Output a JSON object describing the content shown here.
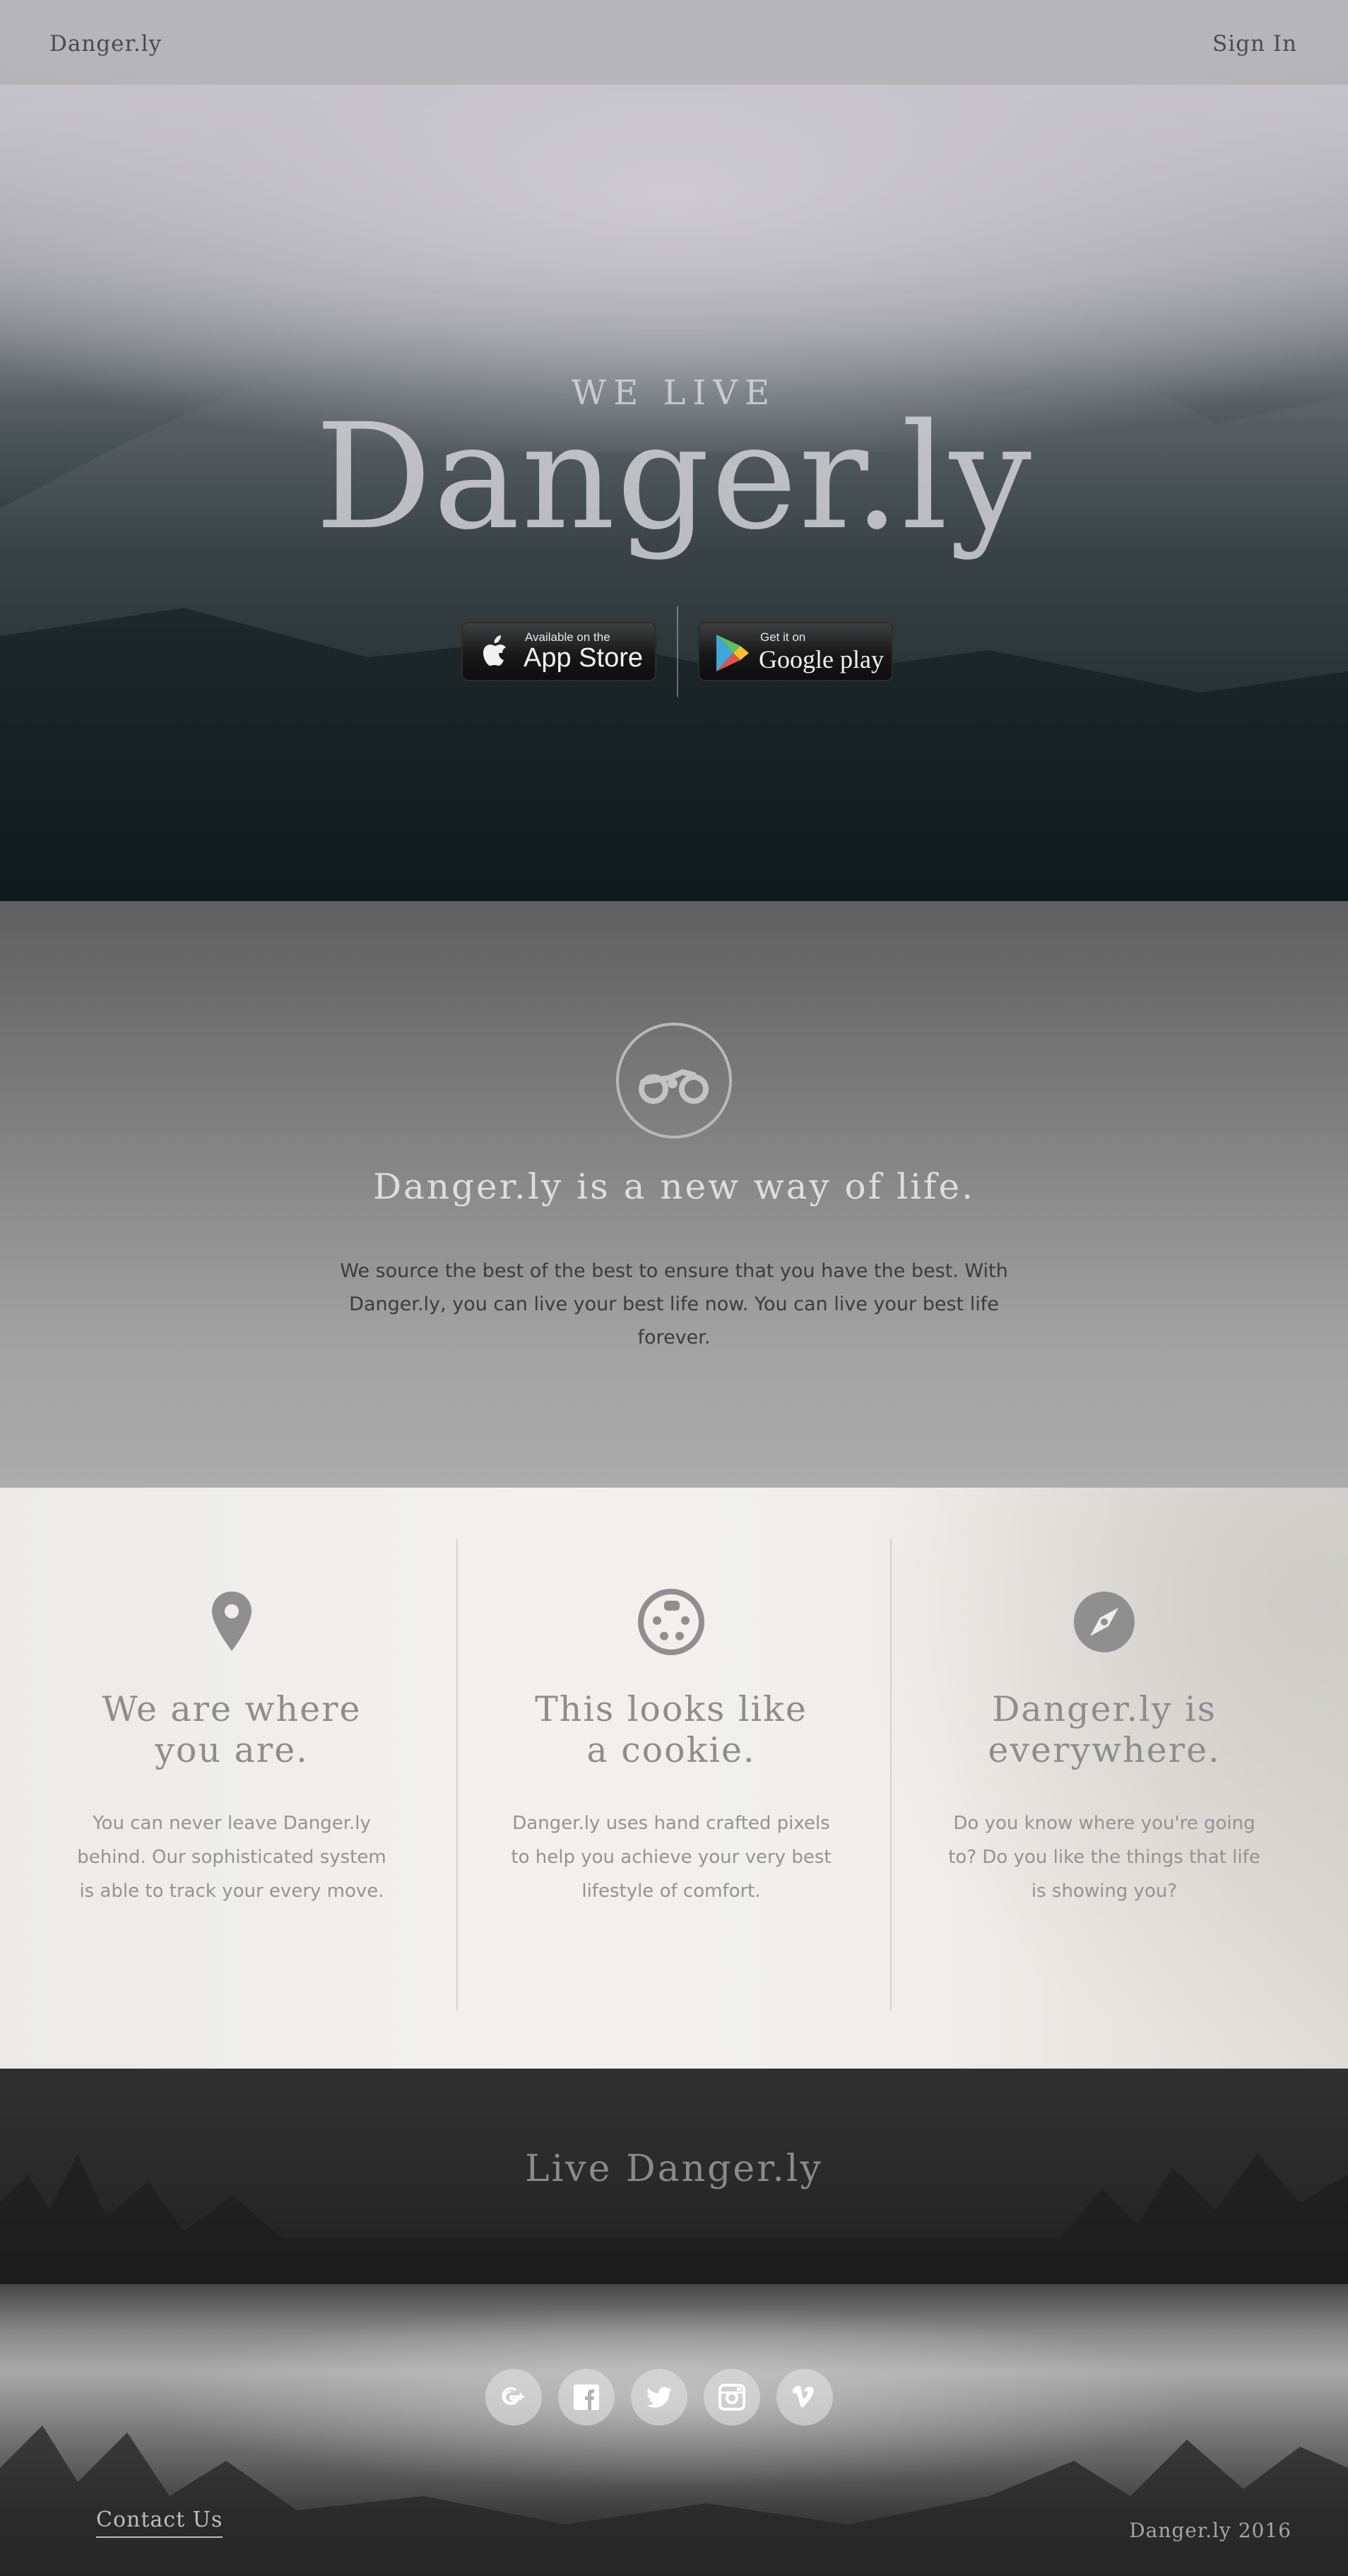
{
  "nav": {
    "brand": "Danger.ly",
    "sign_in": "Sign In"
  },
  "hero": {
    "eyebrow": "WE LIVE",
    "title": "Danger.ly",
    "app_store": {
      "small": "Available on the",
      "big": "App Store",
      "icon": "apple-icon"
    },
    "google_play": {
      "small": "Get it on",
      "big": "Google play",
      "icon": "google-play-icon"
    }
  },
  "about": {
    "icon": "motorcycle-icon",
    "title": "Danger.ly is a new way of life.",
    "text": "We source the best of the best to ensure that you have the best. With Danger.ly, you can live your best life now. You can live your best life forever."
  },
  "features": [
    {
      "icon": "map-pin-icon",
      "title_line1": "We are where",
      "title_line2": "you are.",
      "text": "You can never leave Danger.ly behind. Our sophisticated system is able to track your every move."
    },
    {
      "icon": "cookie-icon",
      "title_line1": "This looks like",
      "title_line2": "a cookie.",
      "text": "Danger.ly uses hand crafted pixels to help you achieve your very best lifestyle of comfort."
    },
    {
      "icon": "compass-icon",
      "title_line1": "Danger.ly is",
      "title_line2": "everywhere.",
      "text": "Do you know where you're going to? Do you like the things that life is showing you?"
    }
  ],
  "cta": {
    "title": "Live Danger.ly"
  },
  "footer": {
    "social": [
      "google-plus-icon",
      "facebook-icon",
      "twitter-icon",
      "instagram-icon",
      "vimeo-icon"
    ],
    "contact": "Contact Us",
    "copyright": "Danger.ly 2016"
  }
}
